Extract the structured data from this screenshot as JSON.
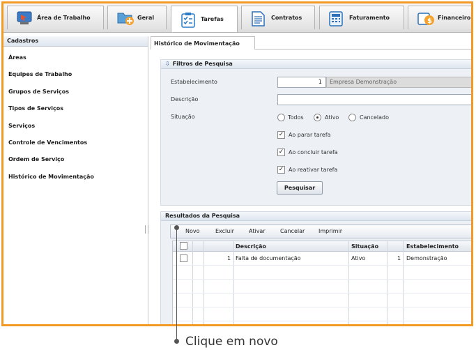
{
  "tabs": [
    {
      "label": "Área de Trabalho",
      "icon": "desktop-icon"
    },
    {
      "label": "Geral",
      "icon": "folder-add-icon"
    },
    {
      "label": "Tarefas",
      "icon": "checklist-icon"
    },
    {
      "label": "Contratos",
      "icon": "document-icon"
    },
    {
      "label": "Faturamento",
      "icon": "calculator-icon"
    },
    {
      "label": "Financeiro",
      "icon": "money-icon"
    }
  ],
  "sidebar": {
    "title": "Cadastros",
    "items": [
      "Áreas",
      "Equipes de Trabalho",
      "Grupos de Serviços",
      "Tipos de Serviços",
      "Serviços",
      "Controle de Vencimentos",
      "Ordem de Serviço",
      "Histórico de Movimentação"
    ]
  },
  "main": {
    "tab_title": "Histórico de Movimentação",
    "filters": {
      "title": "Filtros de Pesquisa",
      "estabelecimento_label": "Estabelecimento",
      "estabelecimento_code": "1",
      "estabelecimento_name": "Empresa Demonstração",
      "descricao_label": "Descrição",
      "descricao_value": "",
      "situacao_label": "Situação",
      "situacao_options": [
        "Todos",
        "Ativo",
        "Cancelado"
      ],
      "situacao_selected": "Ativo",
      "checkboxes": [
        {
          "label": "Ao parar tarefa",
          "checked": true
        },
        {
          "label": "Ao concluir tarefa",
          "checked": true
        },
        {
          "label": "Ao reativar tarefa",
          "checked": true
        }
      ],
      "search_button": "Pesquisar"
    },
    "results": {
      "title": "Resultados da Pesquisa",
      "toolbar": [
        "Novo",
        "Excluir",
        "Ativar",
        "Cancelar",
        "Imprimir"
      ],
      "columns": [
        "Descrição",
        "Situação",
        "Estabelecimento"
      ],
      "rows": [
        {
          "id": "1",
          "descricao": "Falta de documentação",
          "situacao": "Ativo",
          "estab_code": "1",
          "estab_name": "Demonstração"
        }
      ]
    }
  },
  "callout": {
    "text": "Clique em novo"
  },
  "colors": {
    "frame": "#f39a26",
    "panel": "#edf1f6"
  }
}
